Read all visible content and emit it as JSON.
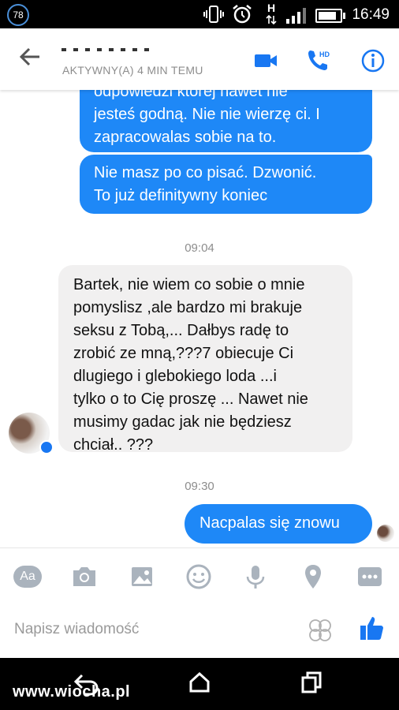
{
  "status_bar": {
    "badge": "78",
    "network_label": "H",
    "time": "16:49"
  },
  "header": {
    "status": "AKTYWNY(A) 4 MIN TEMU",
    "icons": [
      "back-arrow-icon",
      "video-call-icon",
      "hd-call-icon",
      "info-icon"
    ],
    "hd_label": "HD",
    "accent": "#1877f2"
  },
  "messages": {
    "out_1_partial": "odpowiedzi której nawet nie",
    "out_1": [
      "jesteś godną. Nie nie wierzę ci. I",
      "zapracowalas sobie na to."
    ],
    "out_2": [
      "Nie masz po co pisać. Dzwonić.",
      "To już definitywny koniec"
    ],
    "time_1": "09:04",
    "in_1": [
      "Bartek, nie wiem co sobie o mnie",
      "pomyslisz ,ale bardzo mi brakuje",
      "seksu z Tobą,... Dałbys radę to",
      "zrobić ze mną,???7 obiecuje Ci",
      "dlugiego i glebokiego loda ...i",
      "tylko o to Cię proszę ... Nawet nie",
      "musimy gadac jak nie będziesz",
      "chciał.. ???"
    ],
    "time_2": "09:30",
    "out_3": "Nacpalas się znowu"
  },
  "composer": {
    "aa_label": "Aa",
    "placeholder": "Napisz wiadomość",
    "tools": [
      "camera-icon",
      "gallery-icon",
      "emoji-icon",
      "microphone-icon",
      "location-icon",
      "more-icon"
    ]
  },
  "watermark": "www.wiocha.pl",
  "colors": {
    "outgoing": "#1e88f7",
    "incoming": "#f1f0f0",
    "tool_gray": "#aab3bd"
  }
}
